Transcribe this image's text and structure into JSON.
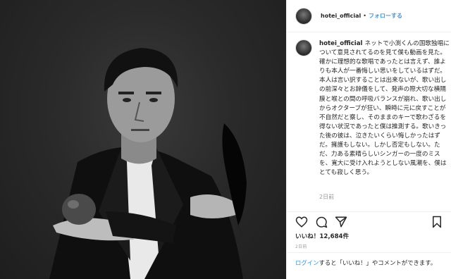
{
  "post": {
    "image_alt": "Black and white portrait of a man in a dark suit holding an apple and a black feather"
  },
  "header": {
    "username": "hotei_official",
    "separator": "•",
    "follow_label": "フォローする"
  },
  "caption": {
    "username": "hotei_official",
    "text": "ネットで小渕くんの国歌独唱について意見されてるのを見て僕も動画を見た。確かに理想的な歌唱であったとは言えず、誰よりも本人が一番悔しい思いをしているはずだ。本人は言い訳することは出来ないが、歌い出しの前深々とお辞儀をして、発声の際大切な横隔膜と喉との間の呼吸バランスが崩れ、歌い出しからオクターブが狂い、瞬時に元に戻すことが不自然だと察し、そのままのキーで歌わざるを得ない状況であったと僕は推測する。歌いきった後の彼は、泣きたいくらい悔しかったはずだ。擁護もしない。しかし否定もしない。ただ、力ある素晴らしいシンガーの一度のミスを、寛大に受け入れようとしない風潮を、僕はとても寂しく思う。",
    "time": "2日前"
  },
  "actions": {
    "like_icon": "heart-icon",
    "comment_icon": "comment-icon",
    "share_icon": "share-icon",
    "save_icon": "bookmark-icon"
  },
  "likes_text": "いいね！12,684件",
  "post_date": "2日前",
  "login_bar": {
    "login_link": "ログイン",
    "rest_text": "すると「いいね！」やコメントができます。"
  },
  "colors": {
    "link": "#3897f0",
    "text": "#262626",
    "muted": "#999999",
    "border": "#efefef"
  }
}
